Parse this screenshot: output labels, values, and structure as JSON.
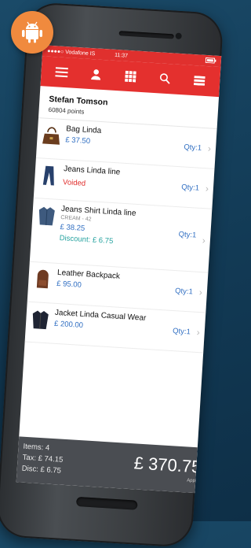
{
  "status": {
    "carrier": "●●●●○ Vodafone IS",
    "time": "11:37"
  },
  "customer": {
    "name": "Stefan Tomson",
    "points": "60804 points"
  },
  "items": [
    {
      "title": "Bag Linda",
      "price": "£ 37.50",
      "qty": "Qty:1"
    },
    {
      "title": "Jeans Linda line",
      "status": "Voided",
      "qty": "Qty:1"
    },
    {
      "title": "Jeans Shirt Linda line",
      "variant": "CREAM - 42",
      "price": "£ 38.25",
      "qty": "Qty:1",
      "discount": "Discount: £ 6.75"
    },
    {
      "title": "Leather Backpack",
      "price": "£ 95.00",
      "qty": "Qty:1"
    },
    {
      "title": "Jacket Linda Casual Wear",
      "price": "£ 200.00",
      "qty": "Qty:1"
    }
  ],
  "summary": {
    "items": "Items: 4",
    "tax": "Tax: £ 74.15",
    "disc": "Disc: £ 6.75",
    "total": "£ 370.75",
    "approve": "Approv"
  },
  "colors": {
    "accent": "#e4302e",
    "badge": "#f08a3e",
    "price": "#2f6ec2",
    "discount": "#27a3a0",
    "footer": "#4a4d52"
  },
  "icons": [
    "android-icon",
    "menu-icon",
    "user-icon",
    "grid-icon",
    "search-icon",
    "barcode-icon",
    "chevron-right-icon"
  ]
}
